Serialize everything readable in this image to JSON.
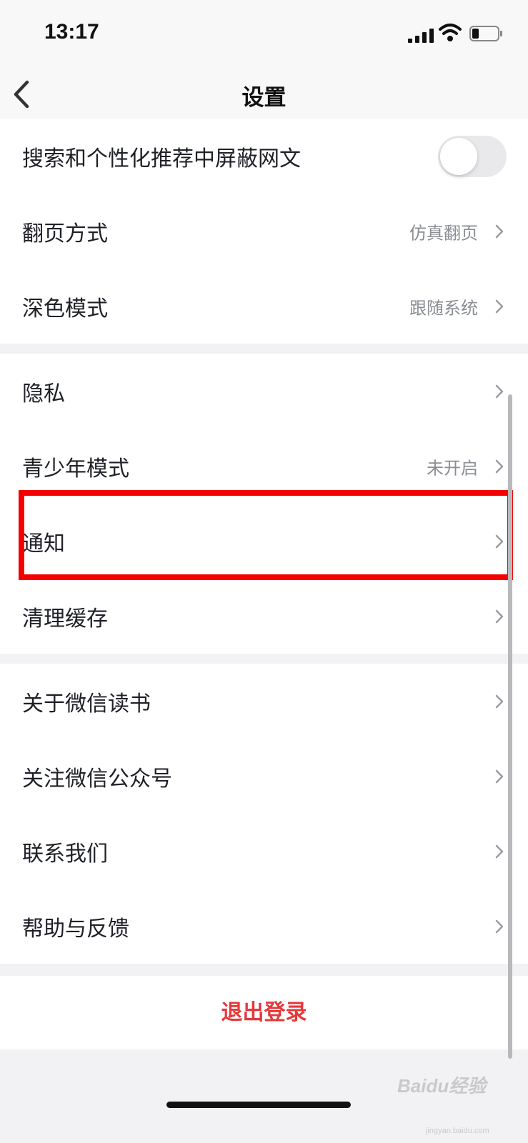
{
  "status_bar": {
    "time": "13:17"
  },
  "nav": {
    "title": "设置"
  },
  "section1": [
    {
      "label": "搜索和个性化推荐中屏蔽网文",
      "toggle": false
    },
    {
      "label": "翻页方式",
      "value": "仿真翻页"
    },
    {
      "label": "深色模式",
      "value": "跟随系统"
    }
  ],
  "section2": [
    {
      "label": "隐私"
    },
    {
      "label": "青少年模式",
      "value": "未开启"
    },
    {
      "label": "通知"
    },
    {
      "label": "清理缓存"
    }
  ],
  "section3": [
    {
      "label": "关于微信读书"
    },
    {
      "label": "关注微信公众号"
    },
    {
      "label": "联系我们"
    },
    {
      "label": "帮助与反馈"
    }
  ],
  "logout": {
    "label": "退出登录"
  },
  "watermark": {
    "main": "Baidu经验",
    "sub": "jingyan.baidu.com"
  },
  "colors": {
    "accent_red": "#e5383b",
    "highlight_red": "#f40000",
    "chevron": "#9a9ca2"
  }
}
